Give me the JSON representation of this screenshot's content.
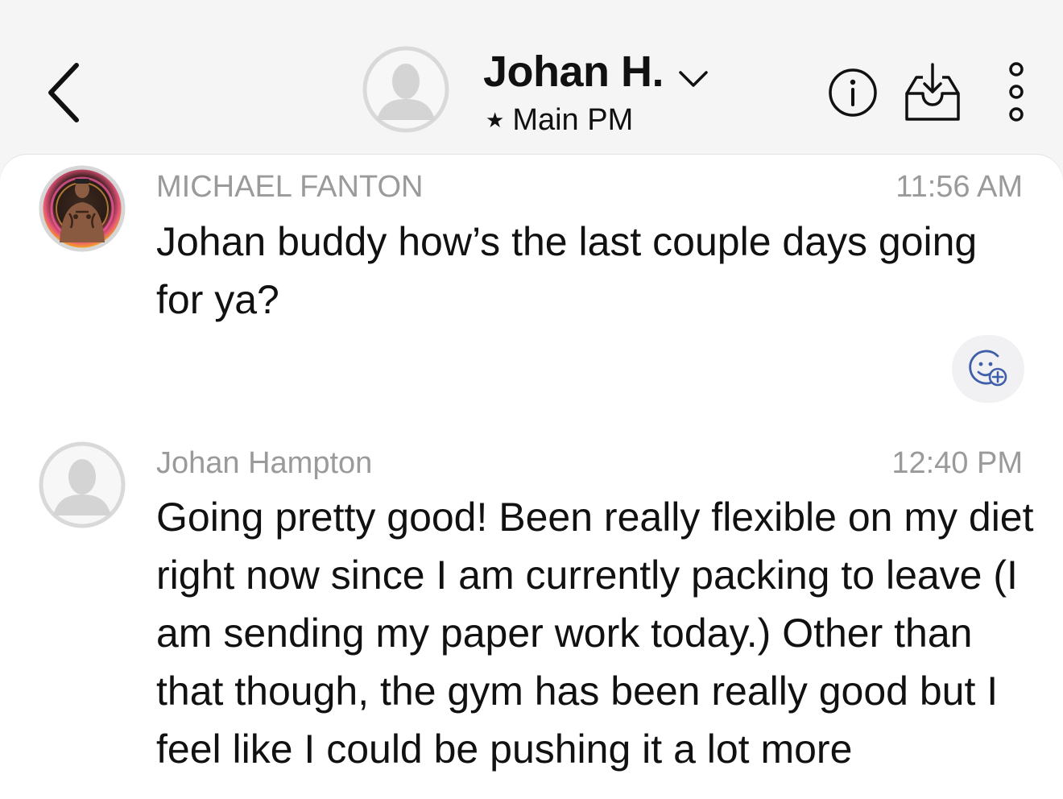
{
  "header": {
    "contact_name": "Johan H.",
    "channel_star": "★",
    "channel": "Main PM",
    "icons": [
      "back-chevron-icon",
      "default-avatar-icon",
      "chevron-down-icon",
      "info-icon",
      "inbox-download-icon",
      "more-vertical-icon"
    ]
  },
  "messages": [
    {
      "sender": "MICHAEL FANTON",
      "time": "11:56 AM",
      "text": "Johan buddy how’s the last couple days going for ya?",
      "reaction_icon": "add-reaction-icon"
    },
    {
      "sender": "Johan Hampton",
      "time": "12:40 PM",
      "text": "Going pretty good! Been really flexible on my diet right now since I am currently packing to leave (I am sending my paper work today.) Other than that though, the gym has been really good but I feel like I could be pushing it a lot more"
    }
  ],
  "colors": {
    "header_bg": "#f5f5f5",
    "panel_bg": "#ffffff",
    "meta_text": "#9a9a9a",
    "body_text": "#111111",
    "reaction_icon": "#3f5fa8"
  }
}
